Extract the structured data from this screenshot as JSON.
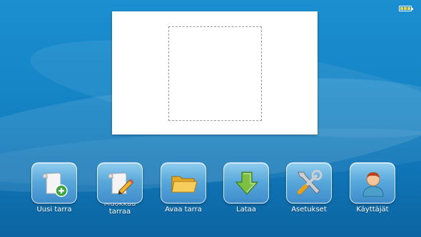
{
  "status": {
    "battery_icon": "battery-icon"
  },
  "toolbar": {
    "items": [
      {
        "label": "Uusi tarra",
        "icon": "new-label-icon"
      },
      {
        "label": "Muokkaa tarraa",
        "icon": "edit-label-icon"
      },
      {
        "label": "Avaa tarra",
        "icon": "open-folder-icon"
      },
      {
        "label": "Lataa",
        "icon": "download-arrow-icon"
      },
      {
        "label": "Asetukset",
        "icon": "settings-tools-icon"
      },
      {
        "label": "Käyttäjät",
        "icon": "user-icon"
      }
    ]
  },
  "colors": {
    "background": "#1585c6",
    "tile": "#5aa9dc",
    "battery_fill": "#f2d94a",
    "add_badge": "#3aa53a",
    "download_arrow": "#7cc043"
  }
}
